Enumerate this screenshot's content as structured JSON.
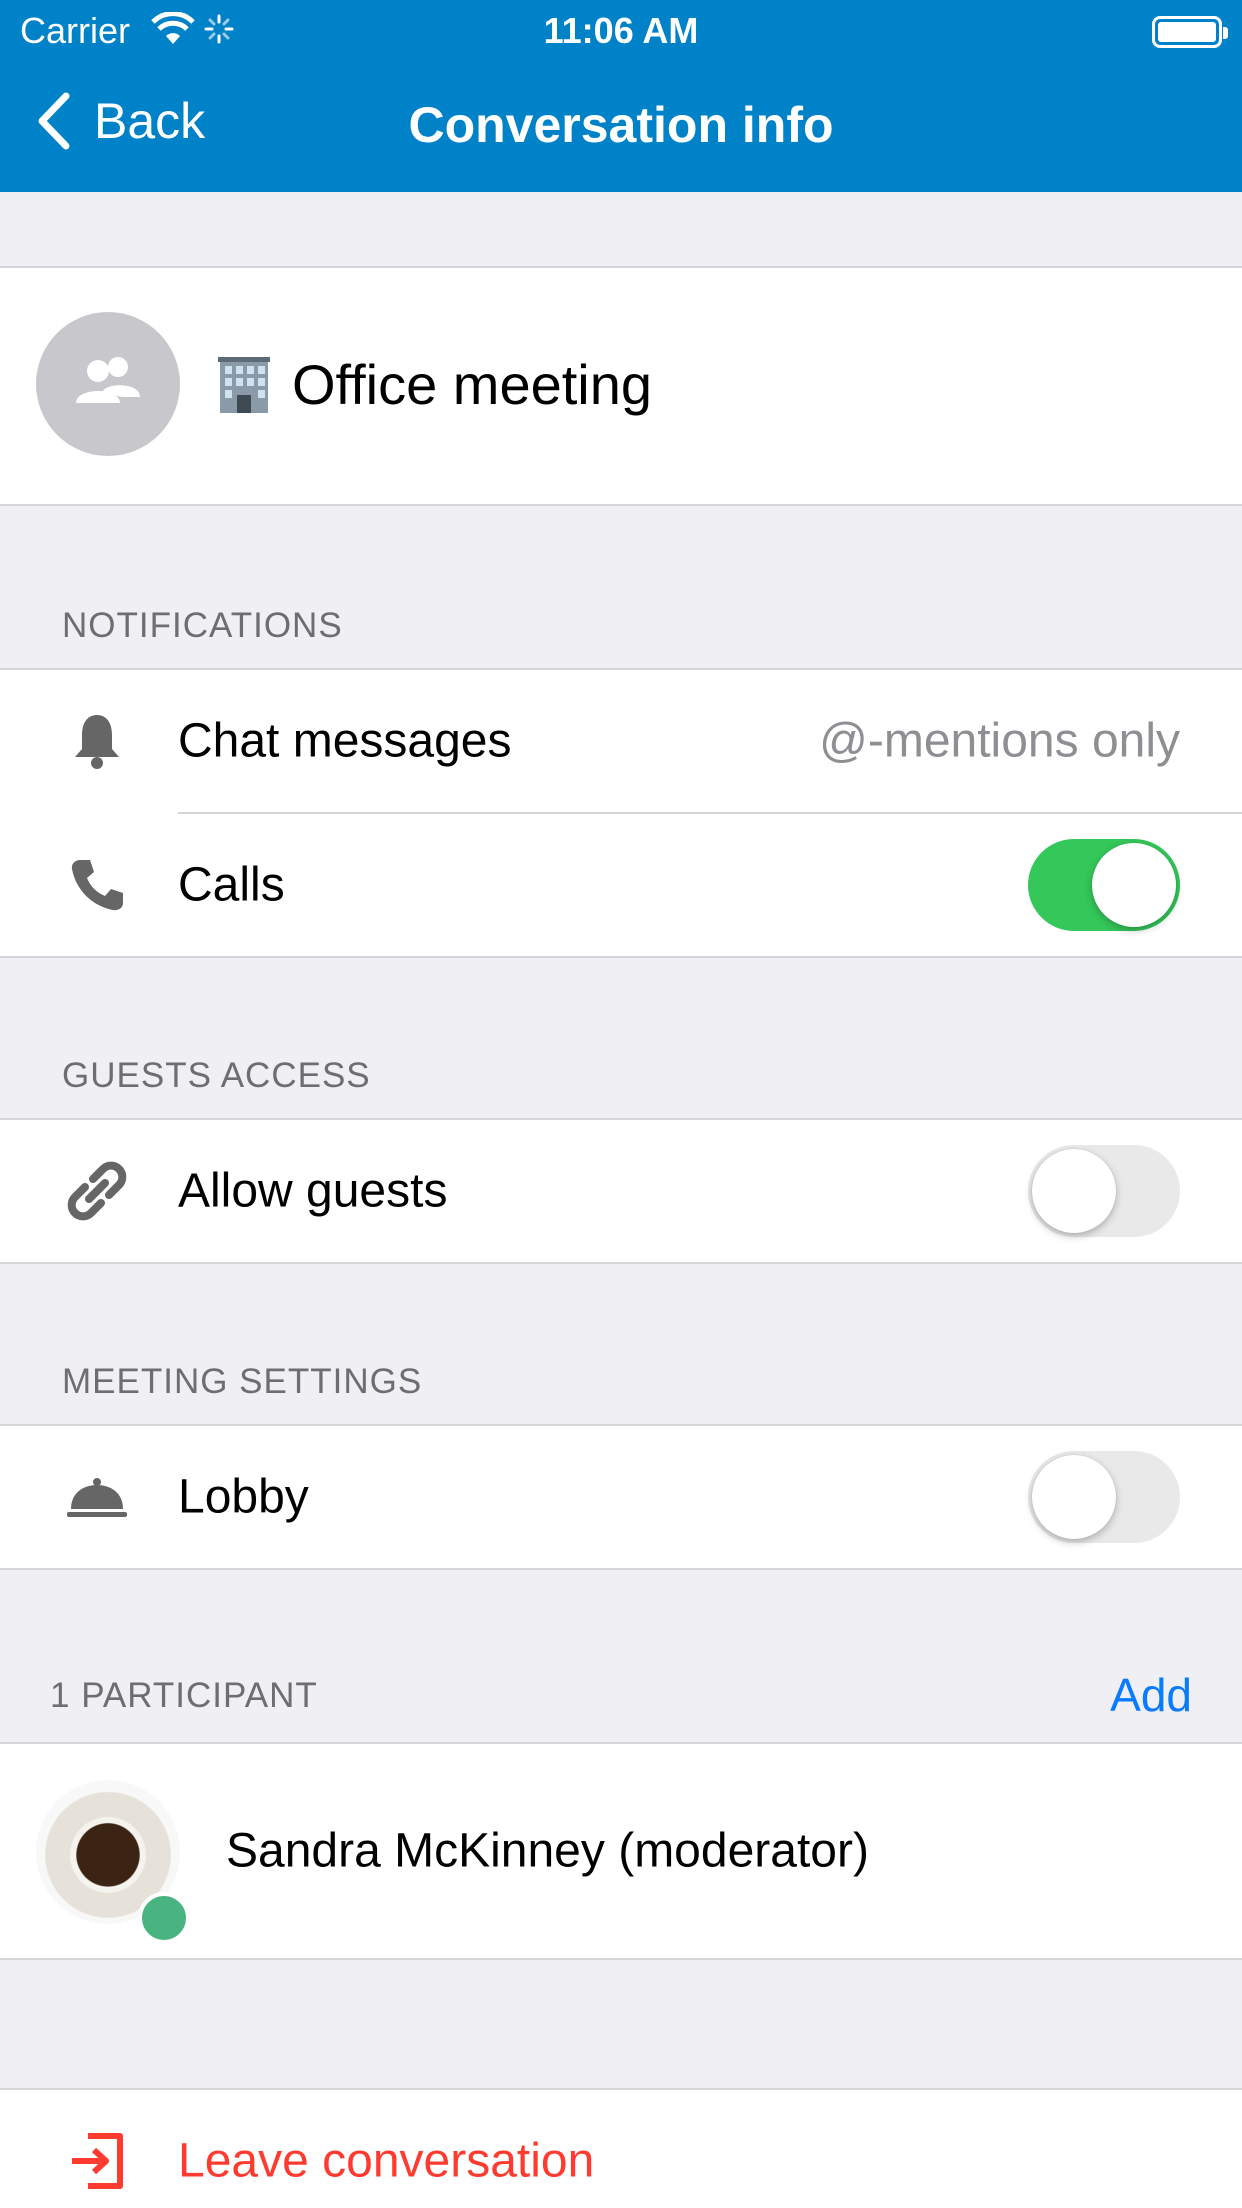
{
  "status_bar": {
    "carrier": "Carrier",
    "time": "11:06 AM"
  },
  "nav": {
    "back_label": "Back",
    "title": "Conversation info"
  },
  "conversation": {
    "name": "Office meeting",
    "avatar_icon": "group-icon",
    "emoji_icon": "office-building-icon"
  },
  "notifications": {
    "header": "NOTIFICATIONS",
    "chat_messages": {
      "label": "Chat messages",
      "value": "@-mentions only",
      "icon": "bell-icon"
    },
    "calls": {
      "label": "Calls",
      "icon": "phone-icon",
      "enabled": true
    }
  },
  "guests_access": {
    "header": "GUESTS ACCESS",
    "allow_guests": {
      "label": "Allow guests",
      "icon": "link-icon",
      "enabled": false
    }
  },
  "meeting_settings": {
    "header": "MEETING SETTINGS",
    "lobby": {
      "label": "Lobby",
      "icon": "lobby-bell-icon",
      "enabled": false
    }
  },
  "participants": {
    "header": "1 PARTICIPANT",
    "add_label": "Add",
    "items": [
      {
        "name": "Sandra McKinney (moderator)",
        "online": true
      }
    ]
  },
  "leave": {
    "label": "Leave conversation",
    "icon": "leave-icon"
  },
  "colors": {
    "nav": "#0082c9",
    "toggle_on": "#34c759",
    "destructive": "#ff3b30",
    "link": "#0a7aff",
    "online": "#49b382"
  }
}
